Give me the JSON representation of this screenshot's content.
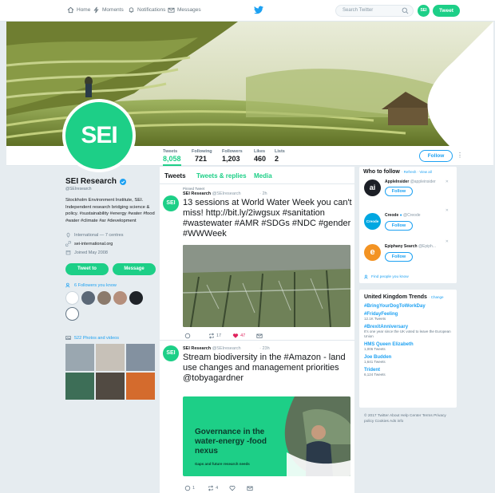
{
  "nav": {
    "home": "Home",
    "moments": "Moments",
    "notifications": "Notifications",
    "messages": "Messages",
    "search_placeholder": "Search Twitter",
    "avatar_text": "SEI",
    "tweet": "Tweet"
  },
  "profile": {
    "avatar_text": "SEI",
    "name": "SEI Research",
    "handle": "@SEIresearch",
    "bio": "Stockholm Environment Institute, SEI. Independent research bridging science & policy. #sustainability #energy #water #food #water #climate #ar #development",
    "location": "International — 7 centres",
    "website": "sei-international.org",
    "joined": "Joined May 2008",
    "tweet_to": "Tweet to",
    "message": "Message",
    "followers_you_know": "6 Followers you know",
    "photos_videos": "522 Photos and videos"
  },
  "stats": [
    {
      "label": "Tweets",
      "value": "8,058"
    },
    {
      "label": "Following",
      "value": "721"
    },
    {
      "label": "Followers",
      "value": "1,203"
    },
    {
      "label": "Likes",
      "value": "460"
    },
    {
      "label": "Lists",
      "value": "2"
    }
  ],
  "follow_button": "Follow",
  "tabs": [
    "Tweets",
    "Tweets & replies",
    "Media"
  ],
  "tweets": [
    {
      "pinned": "Pinned Tweet",
      "name": "SEI Research",
      "handle": "@SEIresearch",
      "time": "· 2h",
      "avatar": "SEI",
      "text": "13 sessions at World Water Week you can't miss! http://bit.ly/2iwgsux #sanitation #wastewater #AMR #SDGs #NDC #gender #WWWeek",
      "retweets": "17",
      "likes": "47"
    },
    {
      "name": "SEI Research",
      "handle": "@SEIresearch",
      "time": "· 23h",
      "avatar": "SEI",
      "text": "Stream biodiversity in the #Amazon - land use changes and management priorities @tobyagardner",
      "replies": "1",
      "retweets": "4",
      "card_title": "Governance in the water-energy -food nexus",
      "card_subtitle": "Gaps and future research needs"
    }
  ],
  "who_to_follow": {
    "title": "Who to follow",
    "links": "· Refresh · View all",
    "accounts": [
      {
        "name": "AppleInsider",
        "handle": "@appleinsider",
        "avatar": "ai",
        "color": "#1c1f26"
      },
      {
        "name": "Creode",
        "handle": "@Creode",
        "avatar": "Creode",
        "color": "#00a7e1"
      },
      {
        "name": "Epiphany Search",
        "handle": "@Epiph...",
        "avatar": "e",
        "color": "#f39323"
      }
    ],
    "follow": "Follow",
    "find_people": "Find people you know"
  },
  "trends": {
    "title": "United Kingdom Trends",
    "change": "· Change",
    "items": [
      {
        "name": "#BringYourDogToWorkDay",
        "desc": ""
      },
      {
        "name": "#FridayFeeling",
        "desc": "12.1K Tweets"
      },
      {
        "name": "#BrexitAnniversary",
        "desc": "It's one year since the UK voted to leave the European Union"
      },
      {
        "name": "HMS Queen Elizabeth",
        "desc": "1,006 Tweets"
      },
      {
        "name": "Joe Budden",
        "desc": "1,641 Tweets"
      },
      {
        "name": "Trident",
        "desc": "6,124 Tweets"
      }
    ]
  },
  "footer": "© 2017 Twitter  About  Help Center  Terms  Privacy policy  Cookies  Ads info",
  "colors": {
    "brand": "#1dcf87",
    "link": "#1da1f2"
  }
}
